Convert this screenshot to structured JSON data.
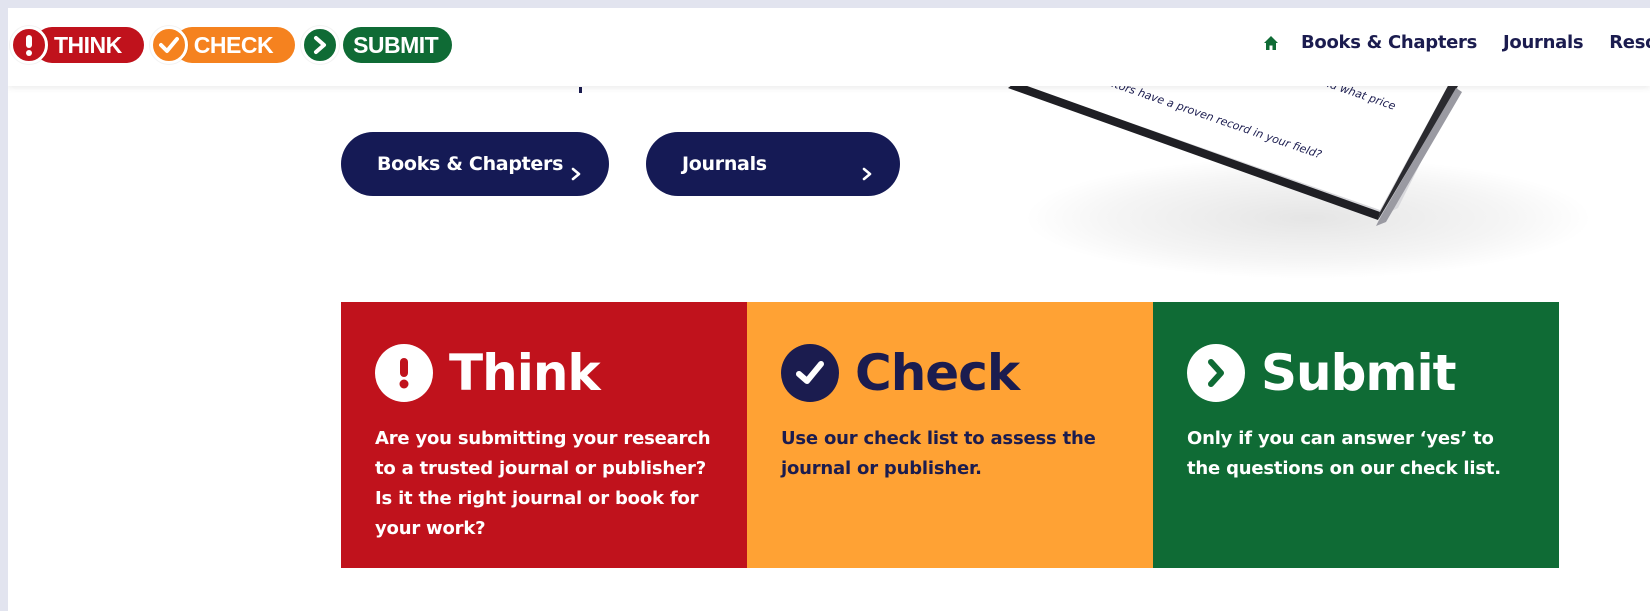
{
  "header": {
    "logo": {
      "think": "THINK",
      "check": "CHECK",
      "submit": "SUBMIT"
    },
    "nav": [
      {
        "label": "Books & Chapters"
      },
      {
        "label": "Journals"
      },
      {
        "label": "Resources"
      }
    ],
    "home_icon": "home-icon"
  },
  "hero": {
    "buttons": [
      {
        "label": "Books & Chapters",
        "icon": "chevron-right-icon"
      },
      {
        "label": "Journals",
        "icon": "chevron-right-icon"
      }
    ],
    "tablet_text": [
      "able in and what price",
      "editors have a proven record in your field?"
    ]
  },
  "cards": [
    {
      "title": "Think",
      "icon": "exclamation-icon",
      "text": "Are you submitting your research to a trusted journal or publisher? Is it the right journal or book for your work?"
    },
    {
      "title": "Check",
      "icon": "checkmark-icon",
      "text": "Use our check list to assess the journal or publisher."
    },
    {
      "title": "Submit",
      "icon": "chevron-right-icon",
      "text": "Only if you can answer ‘yes’ to the questions on our check list."
    }
  ],
  "colors": {
    "red": "#c0121c",
    "orange": "#f5821f",
    "check_bg": "#ffa234",
    "green": "#0f6b35",
    "navy": "#151a55"
  }
}
